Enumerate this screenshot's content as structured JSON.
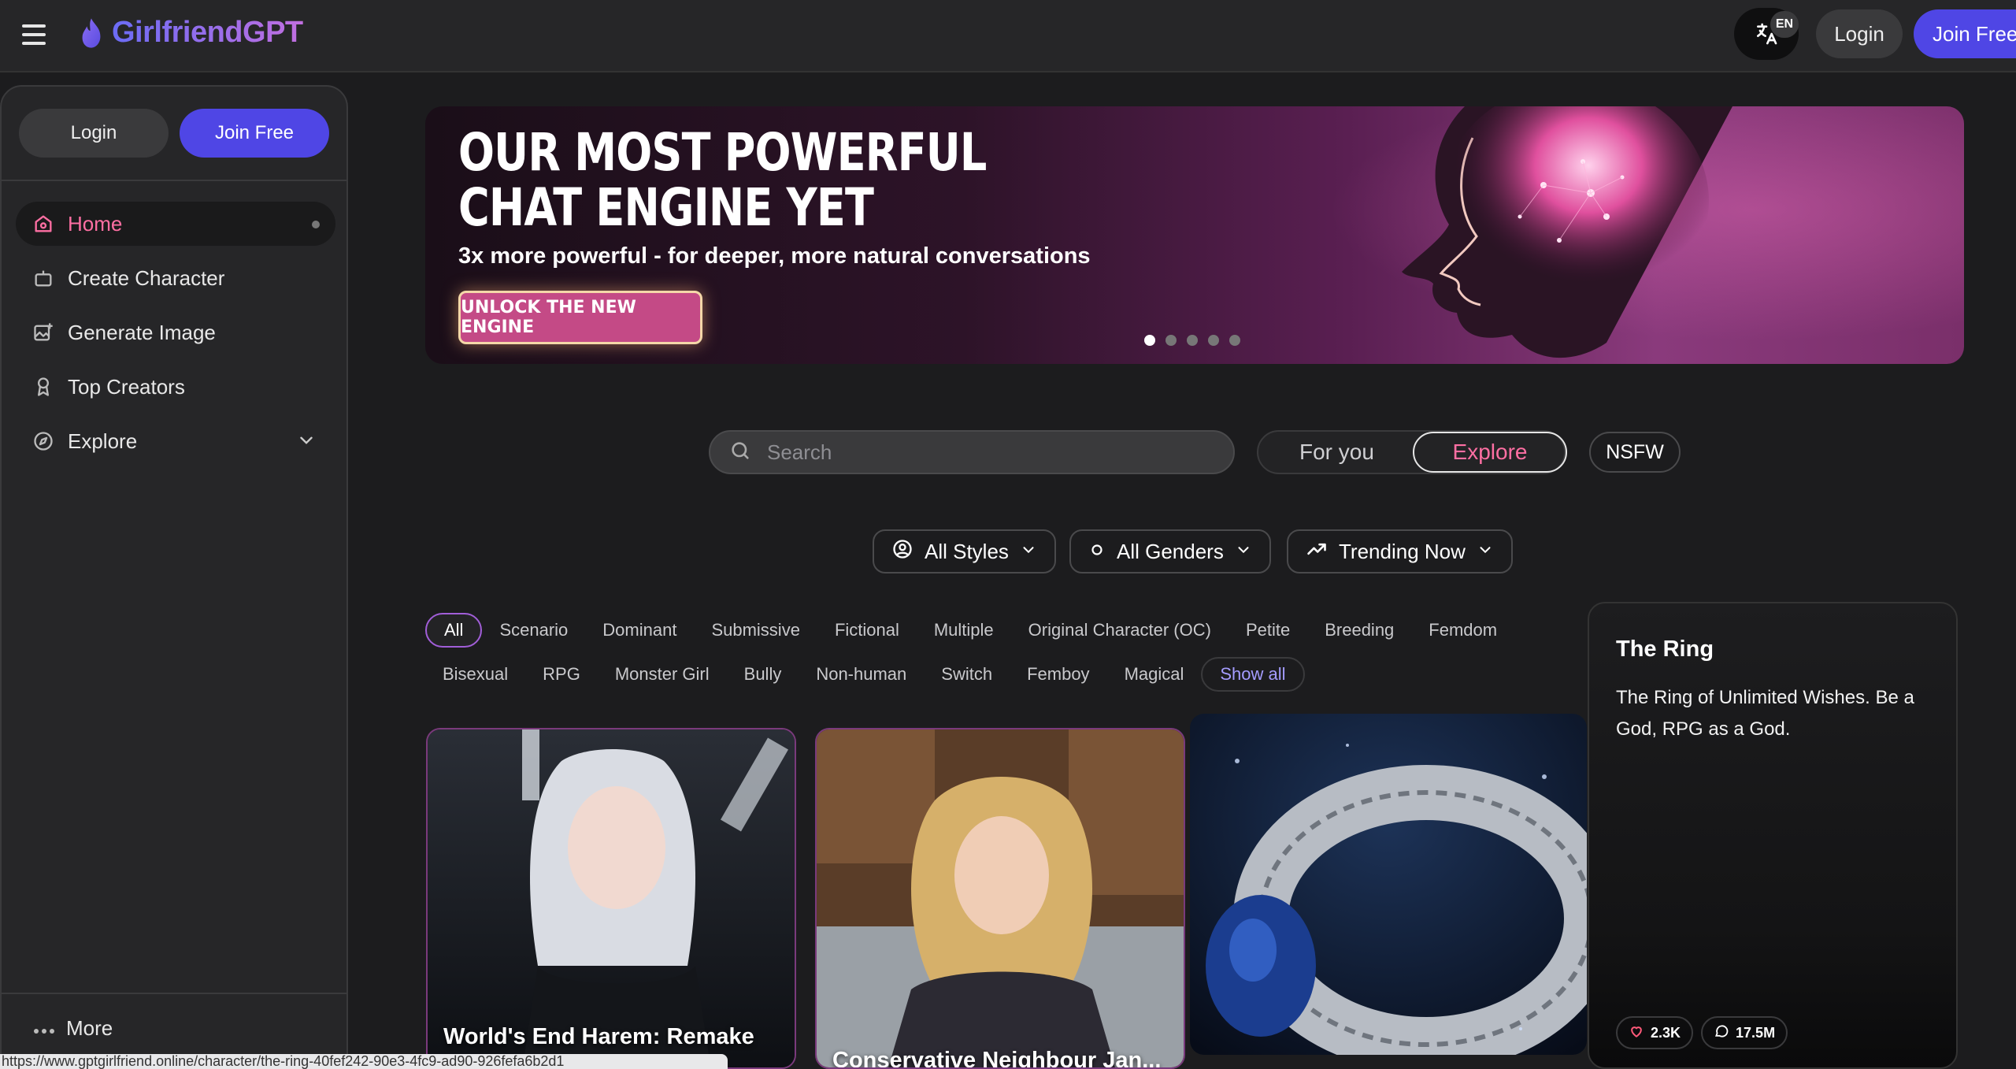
{
  "header": {
    "brand": "GirlfriendGPT",
    "language_badge": "EN",
    "login_label": "Login",
    "join_label": "Join Free"
  },
  "sidebar": {
    "login_label": "Login",
    "join_label": "Join Free",
    "items": [
      {
        "label": "Home",
        "icon": "home-icon",
        "active": true
      },
      {
        "label": "Create Character",
        "icon": "robot-icon"
      },
      {
        "label": "Generate Image",
        "icon": "image-plus-icon"
      },
      {
        "label": "Top Creators",
        "icon": "award-icon"
      },
      {
        "label": "Explore",
        "icon": "compass-icon"
      }
    ],
    "more_label": "More"
  },
  "banner": {
    "headline_line1": "OUR MOST POWERFUL",
    "headline_line2": "CHAT ENGINE YET",
    "subtitle": "3x more powerful - for deeper, more natural conversations",
    "cta_label": "UNLOCK THE NEW ENGINE",
    "slide_count": 5,
    "active_slide": 1
  },
  "search": {
    "placeholder": "Search"
  },
  "feed_toggle": {
    "for_you_label": "For you",
    "explore_label": "Explore",
    "nsfw_label": "NSFW"
  },
  "filters": {
    "styles": "All Styles",
    "genders": "All Genders",
    "sort": "Trending Now"
  },
  "tags": {
    "row1": [
      "All",
      "Scenario",
      "Dominant",
      "Submissive",
      "Fictional",
      "Multiple",
      "Original Character (OC)",
      "Petite",
      "Breeding",
      "Femdom"
    ],
    "row2": [
      "Bisexual",
      "RPG",
      "Monster Girl",
      "Bully",
      "Non-human",
      "Switch",
      "Femboy",
      "Magical"
    ],
    "show_all_label": "Show all"
  },
  "cards": [
    {
      "title": "World's End Harem: Remake"
    },
    {
      "title": "Conservative Neighbour Jan..."
    },
    {
      "title": ""
    }
  ],
  "hover_card": {
    "title": "The Ring",
    "description": "The Ring of Unlimited Wishes. Be a God, RPG as a God.",
    "likes": "2.3K",
    "messages": "17.5M"
  },
  "status_url": "https://www.gptgirlfriend.online/character/the-ring-40fef242-90e3-4fc9-ad90-926fefa6b2d1",
  "colors": {
    "accent_pink": "#ff6fa3",
    "primary_indigo": "#4f46e5",
    "background": "#1c1c1e"
  }
}
